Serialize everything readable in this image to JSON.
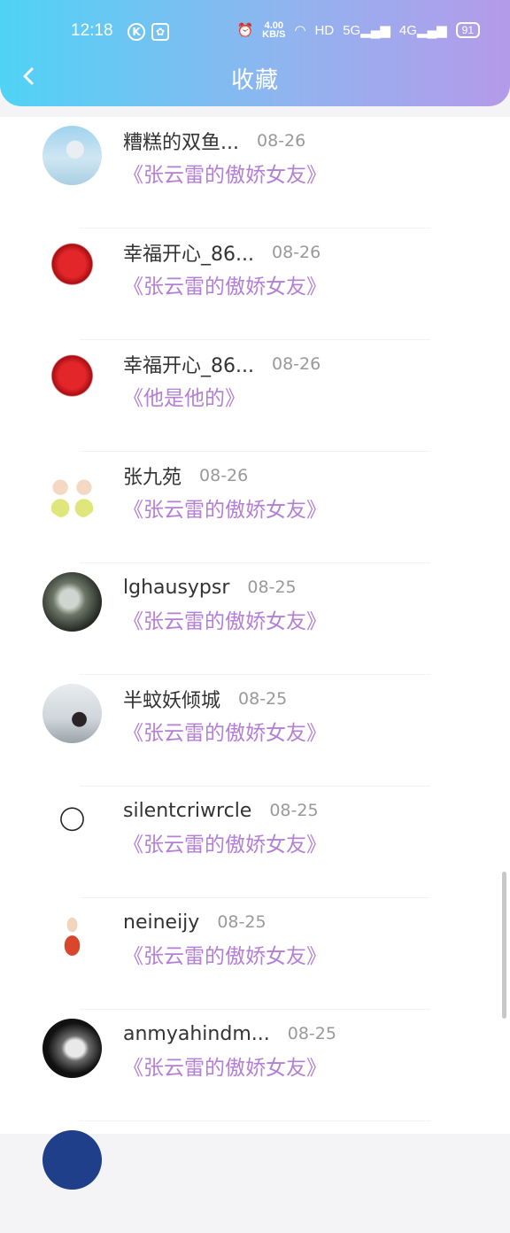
{
  "status_bar": {
    "time": "12:18",
    "k_icon": "K",
    "speed_value": "4.00",
    "speed_unit": "KB/S",
    "hd": "HD",
    "net5g": "5G",
    "net4g": "4G",
    "battery": "91"
  },
  "header": {
    "title": "收藏",
    "back_icon": "chevron-left-icon"
  },
  "items": [
    {
      "name": "糟糕的双鱼...",
      "date": "08-26",
      "work": "《张云雷的傲娇女友》",
      "avatar": "sky-girl"
    },
    {
      "name": "幸福开心_86...",
      "date": "08-26",
      "work": "《张云雷的傲娇女友》",
      "avatar": "red-rose"
    },
    {
      "name": "幸福开心_86...",
      "date": "08-26",
      "work": "《他是他的》",
      "avatar": "red-rose"
    },
    {
      "name": "张九苑",
      "date": "08-26",
      "work": "《张云雷的傲娇女友》",
      "avatar": "cartoon-boys"
    },
    {
      "name": "lghausypsr",
      "date": "08-25",
      "work": "《张云雷的傲娇女友》",
      "avatar": "dark-photo"
    },
    {
      "name": "半蚊妖倾城",
      "date": "08-25",
      "work": "《张云雷的傲娇女友》",
      "avatar": "girl-sky"
    },
    {
      "name": "silentcriwrcle",
      "date": "08-25",
      "work": "《张云雷的傲娇女友》",
      "avatar": "crying-cartoon"
    },
    {
      "name": "neineijy",
      "date": "08-25",
      "work": "《张云雷的傲娇女友》",
      "avatar": "cartoon-figure"
    },
    {
      "name": "anmyahindm...",
      "date": "08-25",
      "work": "《张云雷的傲娇女友》",
      "avatar": "bw-portrait"
    }
  ]
}
